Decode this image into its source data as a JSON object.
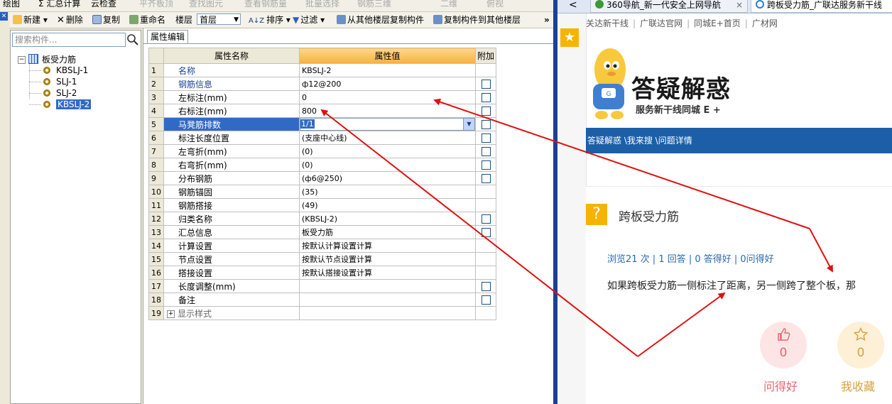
{
  "app": {
    "menu": [
      {
        "label": "绘图",
        "dim": false
      },
      {
        "label": "Σ 汇总计算",
        "dim": false
      },
      {
        "label": "云检查",
        "dim": false
      },
      {
        "label": "平齐板顶",
        "dim": true
      },
      {
        "label": "查找图元",
        "dim": true
      },
      {
        "label": "查看钢筋量",
        "dim": true
      },
      {
        "label": "批量选择",
        "dim": true
      },
      {
        "label": "钢筋三维",
        "dim": true
      },
      {
        "label": "二维",
        "dim": true
      },
      {
        "label": "俯视",
        "dim": true
      }
    ],
    "toolbar": {
      "new": "新建",
      "delete": "删除",
      "copy": "复制",
      "rename": "重命名",
      "floor_label": "楼层",
      "floor_value": "首层",
      "sort": "排序",
      "filter": "过滤",
      "copy_from_floor": "从其他楼层复制构件",
      "copy_to_floor": "复制构件到其他楼层",
      "more": "»"
    },
    "tree": {
      "search_placeholder": "搜索构件...",
      "root": "板受力筋",
      "items": [
        "KBSLJ-1",
        "SLJ-1",
        "SLJ-2",
        "KBSLJ-2"
      ],
      "selected_index": 3
    },
    "props": {
      "tab": "属性编辑",
      "headers": {
        "name": "属性名称",
        "value": "属性值",
        "extra": "附加"
      },
      "rows": [
        {
          "n": "1",
          "name": "名称",
          "value": "KBSLJ-2",
          "blue": true,
          "check": false
        },
        {
          "n": "2",
          "name": "钢筋信息",
          "value": "ф12@200",
          "blue": true,
          "check": true
        },
        {
          "n": "3",
          "name": "左标注(mm)",
          "value": "0",
          "blue": false,
          "check": true
        },
        {
          "n": "4",
          "name": "右标注(mm)",
          "value": "800",
          "blue": false,
          "check": true
        },
        {
          "n": "5",
          "name": "马凳筋排数",
          "value": "1/1",
          "blue": false,
          "check": true,
          "selected": true
        },
        {
          "n": "6",
          "name": "标注长度位置",
          "value": "(支座中心线)",
          "blue": false,
          "check": true
        },
        {
          "n": "7",
          "name": "左弯折(mm)",
          "value": "(0)",
          "blue": false,
          "check": true
        },
        {
          "n": "8",
          "name": "右弯折(mm)",
          "value": "(0)",
          "blue": false,
          "check": true
        },
        {
          "n": "9",
          "name": "分布钢筋",
          "value": "(ф6@250)",
          "blue": false,
          "check": true
        },
        {
          "n": "10",
          "name": "钢筋锚固",
          "value": "(35)",
          "blue": false,
          "check": false
        },
        {
          "n": "11",
          "name": "钢筋搭接",
          "value": "(49)",
          "blue": false,
          "check": false
        },
        {
          "n": "12",
          "name": "归类名称",
          "value": "(KBSLJ-2)",
          "blue": false,
          "check": true
        },
        {
          "n": "13",
          "name": "汇总信息",
          "value": "板受力筋",
          "blue": false,
          "check": true
        },
        {
          "n": "14",
          "name": "计算设置",
          "value": "按默认计算设置计算",
          "blue": false,
          "check": false
        },
        {
          "n": "15",
          "name": "节点设置",
          "value": "按默认节点设置计算",
          "blue": false,
          "check": false
        },
        {
          "n": "16",
          "name": "搭接设置",
          "value": "按默认搭接设置计算",
          "blue": false,
          "check": false
        },
        {
          "n": "17",
          "name": "长度调整(mm)",
          "value": "",
          "blue": false,
          "check": true
        },
        {
          "n": "18",
          "name": "备注",
          "value": "",
          "blue": false,
          "check": true
        },
        {
          "n": "19",
          "name": "显示样式",
          "value": "",
          "blue": false,
          "check": false,
          "expand": true
        }
      ]
    }
  },
  "browser": {
    "tabs": [
      {
        "label": "360导航_新一代安全上网导航",
        "close": "×"
      },
      {
        "label": "跨板受力筋_广联达服务新干线",
        "close": ""
      }
    ],
    "back": "<",
    "site_links": [
      "关达新干线",
      "广联达官网",
      "同城E+首页",
      "广材网"
    ],
    "logo_title": "答疑解惑",
    "logo_sub": "服务新干线同城 E +",
    "breadcrumb": "答疑解惑 \\我来搜 \\问题详情",
    "question": {
      "icon": "?",
      "title": "跨板受力筋",
      "stats": "浏览21 次 | 1 回答 | 0 答得好 | 0问得好",
      "body": "如果跨板受力筋一侧标注了距离，另一侧跨了整个板，那"
    },
    "actions": [
      {
        "count": "0",
        "label": "问得好",
        "icon": "thumbs-up-icon",
        "color": "#e8646e",
        "bg": "#fde5e6"
      },
      {
        "count": "0",
        "label": "我收藏",
        "icon": "star-icon",
        "color": "#d8a040",
        "bg": "#fdf0d6"
      }
    ]
  },
  "colors": {
    "arrow": "#e01010",
    "brand_blue": "#1c5fa7",
    "accent_yellow": "#f5b400"
  }
}
